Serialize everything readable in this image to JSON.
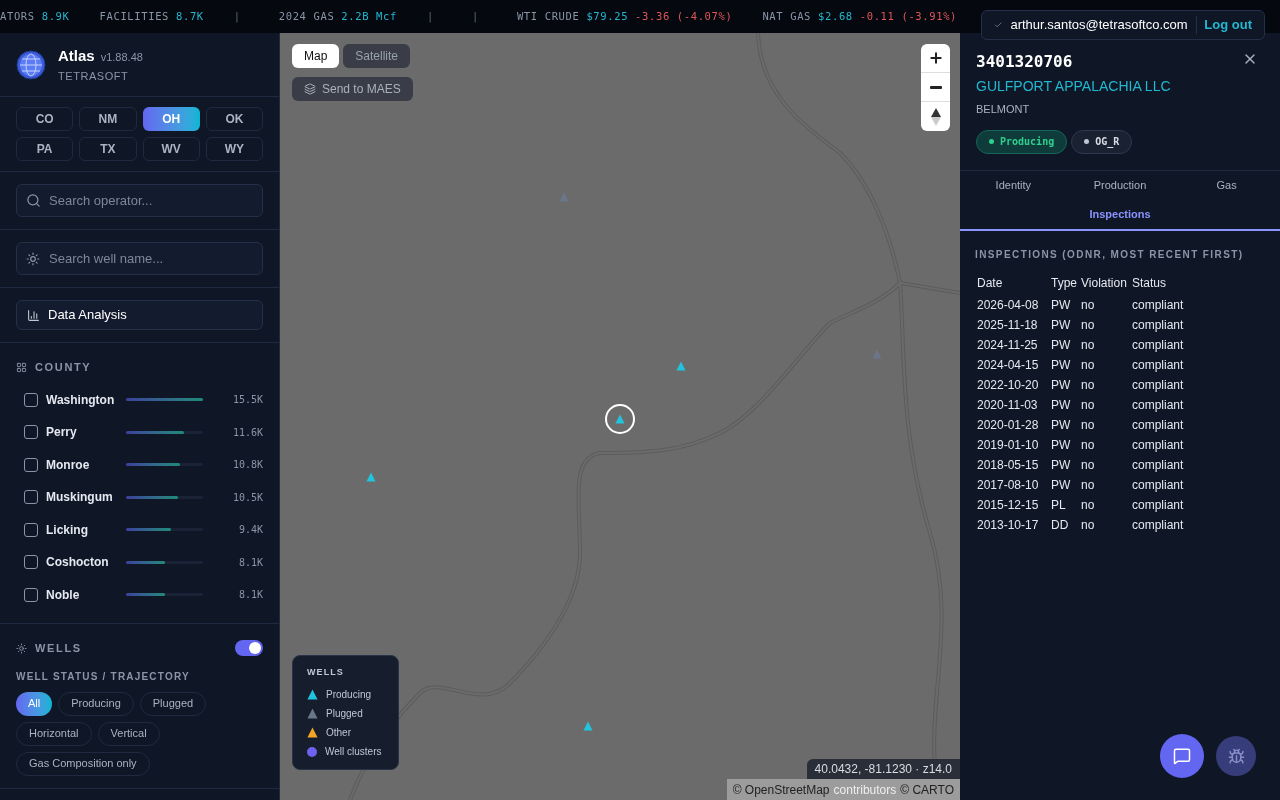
{
  "ticker": [
    {
      "label": "ATORS",
      "value": "8.9K"
    },
    {
      "label": "FACILITIES",
      "value": "8.7K"
    },
    {
      "kind": "sep",
      "label": "|"
    },
    {
      "label": "2024 GAS",
      "value": "2.2B Mcf"
    },
    {
      "kind": "sep",
      "label": "|"
    },
    {
      "kind": "sep",
      "label": "|"
    },
    {
      "label": "WTI CRUDE",
      "value": "$79.25",
      "change": "-3.36 (-4.07%)"
    },
    {
      "label": "NAT GAS",
      "value": "$2.68",
      "change": "-0.11 (-3.91%)"
    }
  ],
  "user": {
    "email": "arthur.santos@tetrasoftco.com",
    "logout": "Log out"
  },
  "app": {
    "name": "Atlas",
    "version": "v1.88.48",
    "company": "TETRASOFT"
  },
  "states": [
    {
      "label": "CO",
      "selected": false
    },
    {
      "label": "NM",
      "selected": false
    },
    {
      "label": "OH",
      "selected": true
    },
    {
      "label": "OK",
      "selected": false
    },
    {
      "label": "PA",
      "selected": false
    },
    {
      "label": "TX",
      "selected": false
    },
    {
      "label": "WV",
      "selected": false
    },
    {
      "label": "WY",
      "selected": false
    }
  ],
  "operator_search": {
    "placeholder": "Search operator..."
  },
  "well_search": {
    "placeholder": "Search well name..."
  },
  "analysis_button": "Data Analysis",
  "county": {
    "title": "COUNTY",
    "items": [
      {
        "name": "Washington",
        "checked": false,
        "level": 1.0,
        "count": "15.5K"
      },
      {
        "name": "Perry",
        "checked": false,
        "level": 0.75,
        "count": "11.6K"
      },
      {
        "name": "Monroe",
        "checked": false,
        "level": 0.7,
        "count": "10.8K"
      },
      {
        "name": "Muskingum",
        "checked": false,
        "level": 0.67,
        "count": "10.5K"
      },
      {
        "name": "Licking",
        "checked": false,
        "level": 0.59,
        "count": "9.4K"
      },
      {
        "name": "Coshocton",
        "checked": false,
        "level": 0.51,
        "count": "8.1K"
      },
      {
        "name": "Noble",
        "checked": false,
        "level": 0.51,
        "count": "8.1K"
      }
    ]
  },
  "wells": {
    "title": "WELLS",
    "on": true,
    "subtitle": "WELL STATUS / TRAJECTORY",
    "filters": [
      {
        "label": "All",
        "selected": true
      },
      {
        "label": "Producing",
        "selected": false
      },
      {
        "label": "Plugged",
        "selected": false
      },
      {
        "label": "Horizontal",
        "selected": false
      },
      {
        "label": "Vertical",
        "selected": false
      },
      {
        "label": "Gas Composition only",
        "selected": false
      }
    ]
  },
  "map": {
    "layers": [
      {
        "label": "Map",
        "selected": true
      },
      {
        "label": "Satellite",
        "selected": false
      }
    ],
    "send_button": "Send to MAES",
    "markers": [
      {
        "kind": "plugged",
        "selected": false
      },
      {
        "kind": "producing",
        "selected": false
      },
      {
        "kind": "plugged",
        "selected": false
      },
      {
        "kind": "producing",
        "selected": true
      },
      {
        "kind": "producing",
        "selected": false
      },
      {
        "kind": "producing",
        "selected": false
      }
    ],
    "legend": {
      "title": "WELLS",
      "items": [
        {
          "label": "Producing",
          "kind": "triangle",
          "color": "#22c3dc"
        },
        {
          "label": "Plugged",
          "kind": "triangle",
          "color": "#6b7689"
        },
        {
          "label": "Other",
          "kind": "triangle",
          "color": "#f5a524"
        },
        {
          "label": "Well clusters",
          "kind": "circle",
          "color": "#6d63f0"
        }
      ]
    },
    "coordinates": "40.0432, -81.1230 · z14.0",
    "attribution": [
      {
        "text": "© OpenStreetMap",
        "kind": "dark"
      },
      {
        "text": "contributors",
        "kind": "light"
      },
      {
        "text": "© CARTO",
        "kind": "dark"
      }
    ]
  },
  "well": {
    "api": "3401320706",
    "operator": "GULFPORT APPALACHIA LLC",
    "county": "BELMONT",
    "tags": [
      {
        "label": "Producing",
        "kind": "status"
      },
      {
        "label": "OG_R",
        "kind": "type"
      }
    ],
    "tabs": [
      {
        "label": "Identity",
        "selected": false
      },
      {
        "label": "Production",
        "selected": false
      },
      {
        "label": "Gas",
        "selected": false
      },
      {
        "label": "Inspections",
        "selected": true
      }
    ],
    "section_title": "INSPECTIONS (ODNR, MOST RECENT FIRST)",
    "columns": [
      "Date",
      "Type",
      "Violation",
      "Status"
    ],
    "rows": [
      [
        "2026-04-08",
        "PW",
        "no",
        "compliant"
      ],
      [
        "2025-11-18",
        "PW",
        "no",
        "compliant"
      ],
      [
        "2024-11-25",
        "PW",
        "no",
        "compliant"
      ],
      [
        "2024-04-15",
        "PW",
        "no",
        "compliant"
      ],
      [
        "2022-10-20",
        "PW",
        "no",
        "compliant"
      ],
      [
        "2020-11-03",
        "PW",
        "no",
        "compliant"
      ],
      [
        "2020-01-28",
        "PW",
        "no",
        "compliant"
      ],
      [
        "2019-01-10",
        "PW",
        "no",
        "compliant"
      ],
      [
        "2018-05-15",
        "PW",
        "no",
        "compliant"
      ],
      [
        "2017-08-10",
        "PW",
        "no",
        "compliant"
      ],
      [
        "2015-12-15",
        "PL",
        "no",
        "compliant"
      ],
      [
        "2013-10-17",
        "DD",
        "no",
        "compliant"
      ]
    ]
  }
}
